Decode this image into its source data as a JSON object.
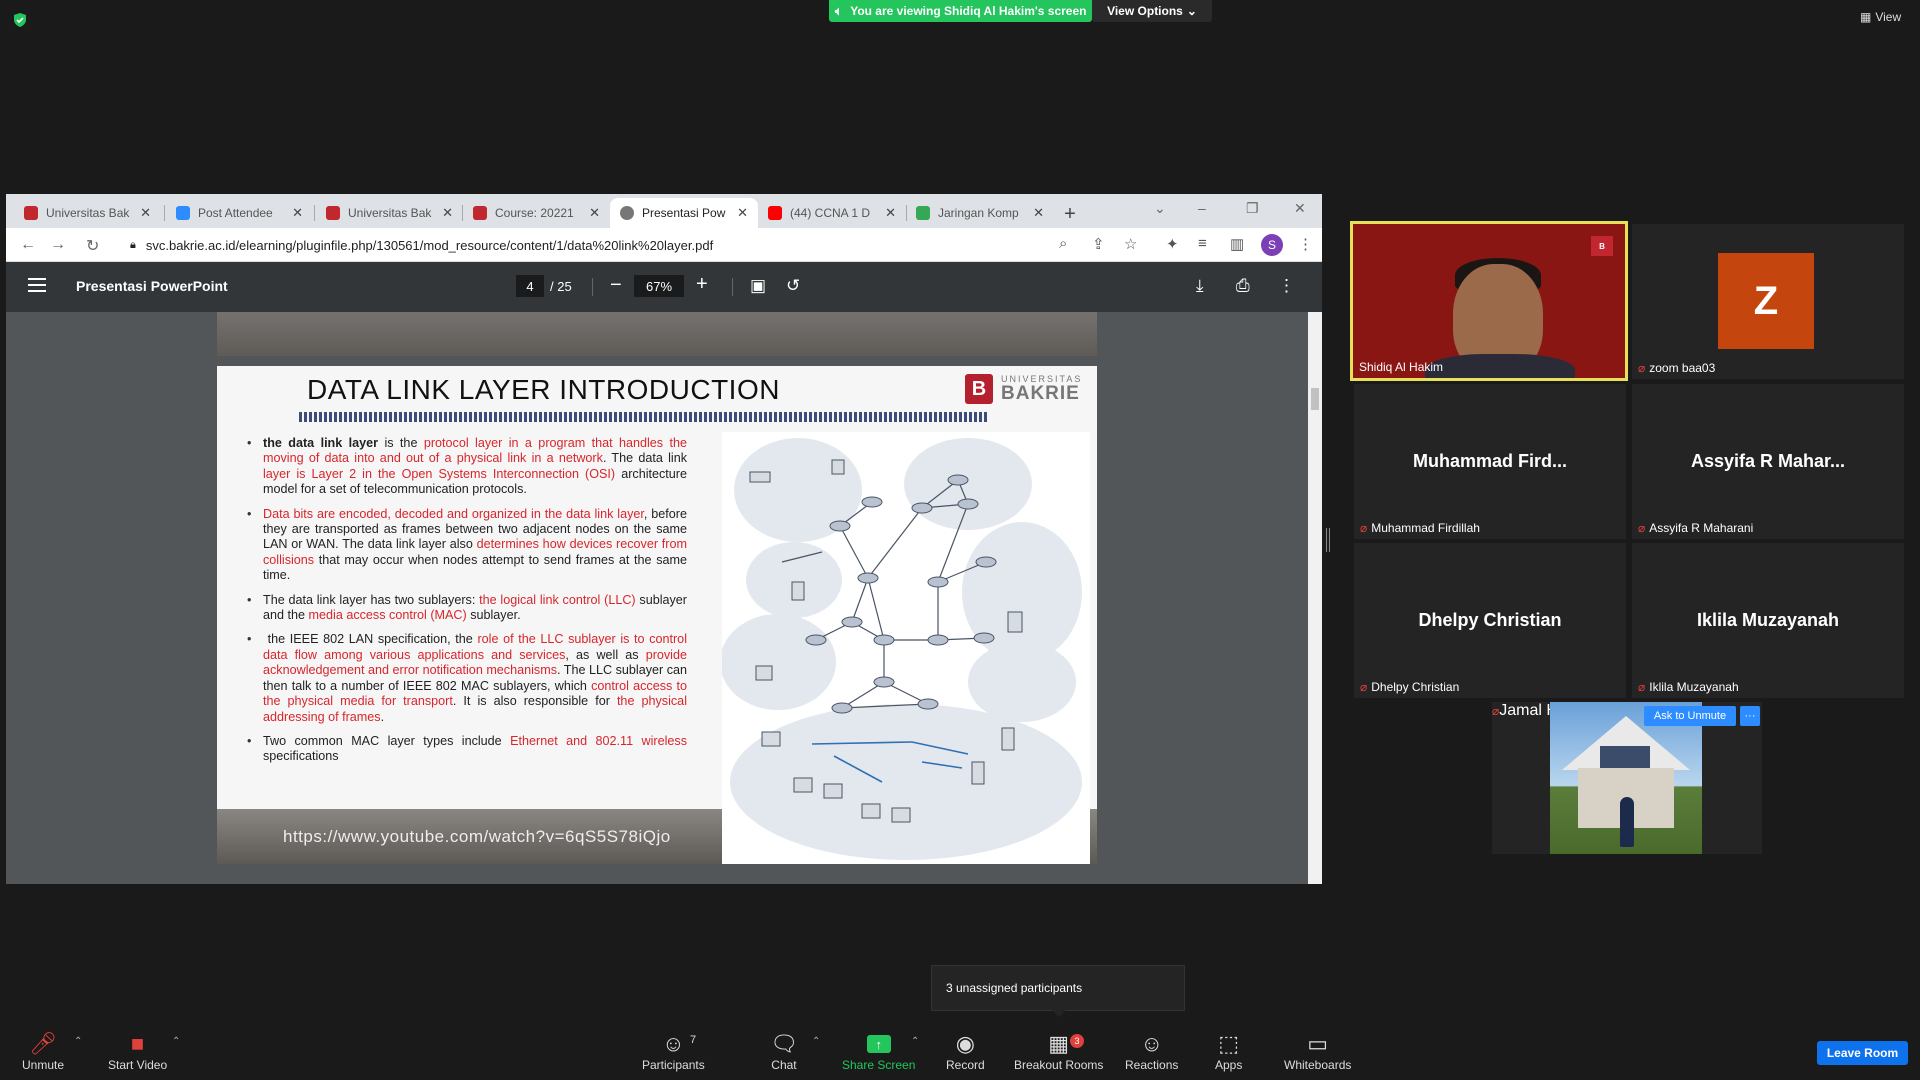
{
  "top_bar": {
    "viewing_text": "You are viewing Shidiq Al Hakim's screen",
    "view_options": "View Options",
    "view_label": "View"
  },
  "browser": {
    "tabs": [
      {
        "label": "Universitas Bak",
        "color": "#c0282d"
      },
      {
        "label": "Post Attendee",
        "color": "#2d8cff"
      },
      {
        "label": "Universitas Bak",
        "color": "#c0282d"
      },
      {
        "label": "Course: 20221",
        "color": "#c0282d"
      },
      {
        "label": "Presentasi Pow",
        "color": "#777777"
      },
      {
        "label": "(44) CCNA 1 D",
        "color": "#ff0000"
      },
      {
        "label": "Jaringan Komp",
        "color": "#34a853"
      }
    ],
    "url": "svc.bakrie.ac.id/elearning/pluginfile.php/130561/mod_resource/content/1/data%20link%20layer.pdf",
    "profile_initial": "S"
  },
  "pdf": {
    "title": "Presentasi PowerPoint",
    "page_current": "4",
    "page_total": "/ 25",
    "zoom": "67%"
  },
  "slide": {
    "title": "DATA LINK LAYER INTRODUCTION",
    "logo_line1": "UNIVERSITAS",
    "logo_line2": "BAKRIE",
    "logo_letter": "B",
    "footer_url": "https://www.youtube.com/watch?v=6qS5S78iQjo"
  },
  "participants": {
    "shidiq": "Shidiq Al Hakim",
    "zoom_initial": "Z",
    "zoom_name": "zoom baa03",
    "muhammad_big": "Muhammad  Fird...",
    "muhammad_name": "Muhammad Firdillah",
    "assyifa_big": "Assyifa R Mahar...",
    "assyifa_name": "Assyifa R Maharani",
    "dhelpy_big": "Dhelpy Christian",
    "dhelpy_name": "Dhelpy Christian",
    "iklila_big": "Iklila Muzayanah",
    "iklila_name": "Iklila Muzayanah",
    "jamal_name": "Jamal Hudri",
    "ask_to_unmute": "Ask to Unmute",
    "more": "···"
  },
  "tooltip": "3 unassigned participants",
  "controls": {
    "unmute": "Unmute",
    "start_video": "Start Video",
    "participants": "Participants",
    "participants_count": "7",
    "chat": "Chat",
    "share_screen": "Share Screen",
    "record": "Record",
    "breakout_rooms": "Breakout Rooms",
    "breakout_badge": "3",
    "reactions": "Reactions",
    "apps": "Apps",
    "whiteboards": "Whiteboards",
    "leave_room": "Leave Room"
  }
}
